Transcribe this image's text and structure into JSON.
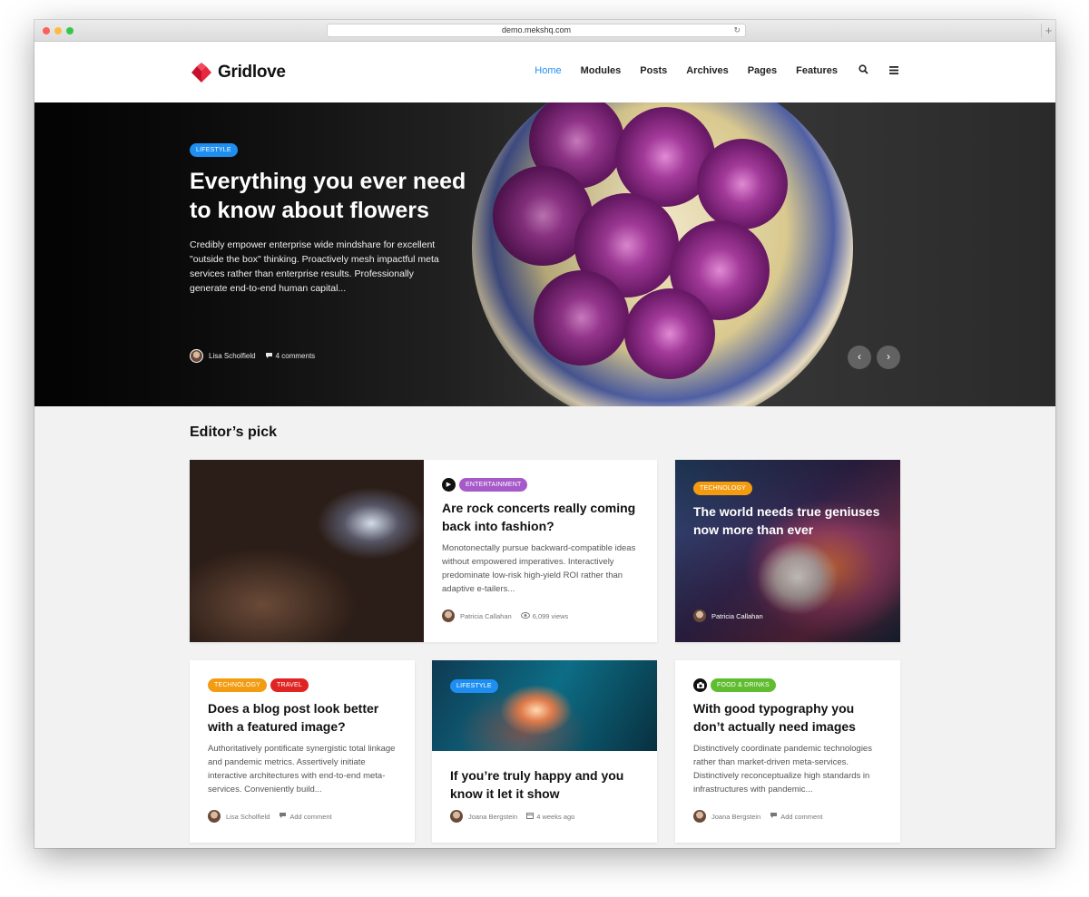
{
  "browser": {
    "url": "demo.mekshq.com",
    "reload_icon": "reload-icon",
    "new_tab": "+"
  },
  "header": {
    "logo": "Gridlove",
    "nav": [
      "Home",
      "Modules",
      "Posts",
      "Archives",
      "Pages",
      "Features"
    ],
    "active_nav": "Home",
    "search_icon": "search-icon",
    "menu_icon": "hamburger-icon",
    "accent_color": "#1e8ff1"
  },
  "hero": {
    "tag": "LIFESTYLE",
    "title": "Everything you ever need to know about flowers",
    "excerpt": "Credibly empower enterprise wide mindshare for excellent \"outside the box\" thinking. Proactively mesh impactful meta services rather than enterprise results. Professionally generate end-to-end human capital...",
    "author": "Lisa Scholfield",
    "comments": "4 comments",
    "prev": "‹",
    "next": "›"
  },
  "section": {
    "title": "Editor’s pick"
  },
  "cards": [
    {
      "tags": [
        "ENTERTAINMENT"
      ],
      "title": "Are rock concerts really coming back into fashion?",
      "excerpt": "Monotonectally pursue backward-compatible ideas without empowered imperatives. Interactively predominate low-risk high-yield ROI rather than adaptive e-tailers...",
      "author": "Patricia Callahan",
      "stat": "6,099 views"
    },
    {
      "tags": [
        "TECHNOLOGY"
      ],
      "title": "The world needs true geniuses now more than ever",
      "author": "Patricia Callahan"
    },
    {
      "tags": [
        "TECHNOLOGY",
        "TRAVEL"
      ],
      "title": "Does a blog post look better with a featured image?",
      "excerpt": "Authoritatively pontificate synergistic total linkage and pandemic metrics. Assertively initiate interactive architectures with end-to-end meta-services. Conveniently build...",
      "author": "Lisa Scholfield",
      "stat": "Add comment"
    },
    {
      "tags": [
        "LIFESTYLE"
      ],
      "title": "If you’re truly happy and you know it let it show",
      "author": "Joana Bergstein",
      "stat": "4 weeks ago"
    },
    {
      "tags": [
        "FOOD & DRINKS"
      ],
      "title": "With good typography you don’t actually need images",
      "excerpt": "Distinctively coordinate pandemic technologies rather than market-driven meta-services. Distinctively reconceptualize high standards in infrastructures with pandemic...",
      "author": "Joana Bergstein",
      "stat": "Add comment"
    }
  ]
}
